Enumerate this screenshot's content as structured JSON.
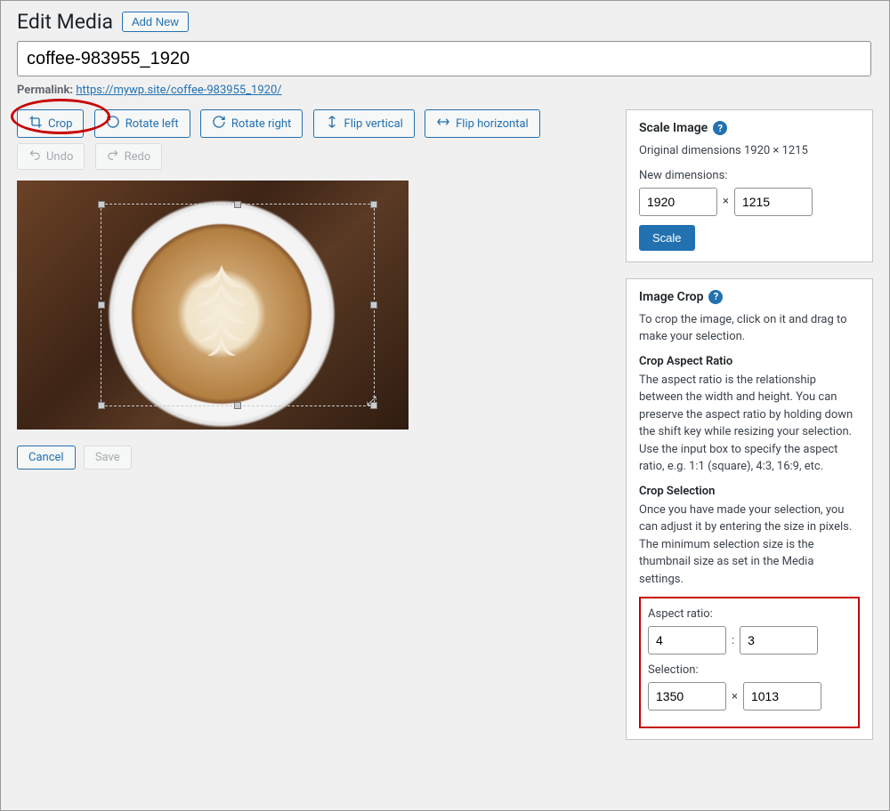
{
  "header": {
    "title": "Edit Media",
    "add_new_label": "Add New"
  },
  "title_input": {
    "value": "coffee-983955_1920"
  },
  "permalink": {
    "label": "Permalink:",
    "url_text": "https://mywp.site/coffee-983955_1920/"
  },
  "toolbar": {
    "crop": "Crop",
    "rotate_left": "Rotate left",
    "rotate_right": "Rotate right",
    "flip_vertical": "Flip vertical",
    "flip_horizontal": "Flip horizontal",
    "undo": "Undo",
    "redo": "Redo"
  },
  "bottom": {
    "cancel": "Cancel",
    "save": "Save"
  },
  "scale_panel": {
    "title": "Scale Image",
    "original": "Original dimensions 1920 × 1215",
    "new_dims_label": "New dimensions:",
    "width": "1920",
    "height": "1215",
    "scale_btn": "Scale"
  },
  "crop_panel": {
    "title": "Image Crop",
    "intro": "To crop the image, click on it and drag to make your selection.",
    "ar_title": "Crop Aspect Ratio",
    "ar_body": "The aspect ratio is the relationship between the width and height. You can preserve the aspect ratio by holding down the shift key while resizing your selection. Use the input box to specify the aspect ratio, e.g. 1:1 (square), 4:3, 16:9, etc.",
    "sel_title": "Crop Selection",
    "sel_body": "Once you have made your selection, you can adjust it by entering the size in pixels. The minimum selection size is the thumbnail size as set in the Media settings.",
    "ar_label": "Aspect ratio:",
    "ar_w": "4",
    "ar_h": "3",
    "sel_label": "Selection:",
    "sel_w": "1350",
    "sel_h": "1013"
  }
}
